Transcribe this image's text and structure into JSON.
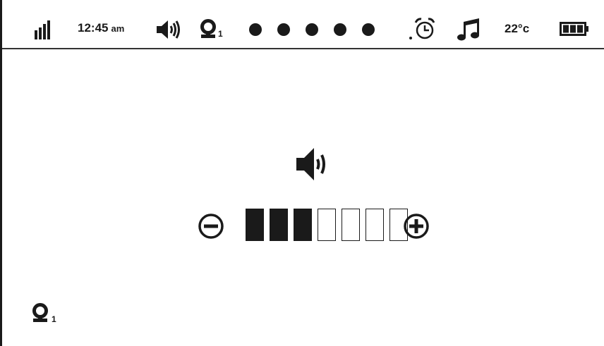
{
  "status_bar": {
    "time": "12:45",
    "time_suffix": "am",
    "camera_number": "1",
    "temperature": "22°c",
    "page_dots": 5,
    "icons": [
      "signal-icon",
      "speaker-icon",
      "camera-icon",
      "alarm-clock-icon",
      "music-note-icon",
      "battery-icon"
    ]
  },
  "volume": {
    "level": 3,
    "max": 7,
    "icons": [
      "speaker-icon",
      "minus-circle-icon",
      "plus-circle-icon"
    ]
  },
  "footer": {
    "camera_number": "1",
    "icon": "camera-icon"
  }
}
